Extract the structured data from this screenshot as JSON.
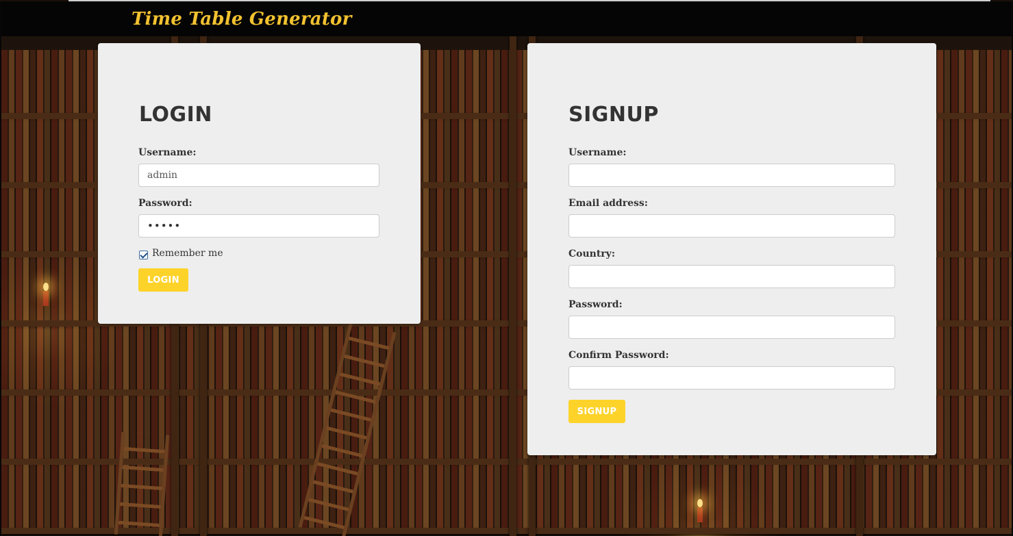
{
  "header": {
    "brand": "Time Table Generator"
  },
  "login": {
    "title": "LOGIN",
    "username_label": "Username:",
    "username_value": "admin",
    "password_label": "Password:",
    "password_value": "•••••",
    "remember_label": "Remember me",
    "remember_checked": true,
    "button_label": "LOGIN"
  },
  "signup": {
    "title": "SIGNUP",
    "username_label": "Username:",
    "email_label": "Email address:",
    "country_label": "Country:",
    "password_label": "Password:",
    "confirm_label": "Confirm Password:",
    "button_label": "SIGNUP"
  },
  "colors": {
    "accent": "#fdd32a",
    "brand": "#f3c230",
    "card": "#eeeeee",
    "navbar": "#050505"
  }
}
